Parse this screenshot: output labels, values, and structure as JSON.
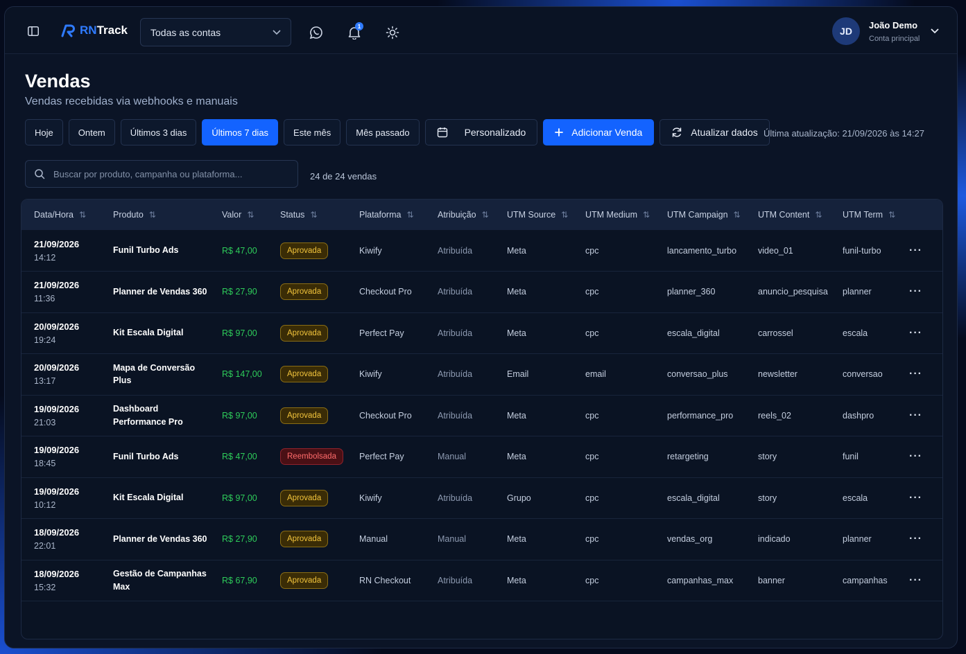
{
  "header": {
    "brand_prefix": "RN",
    "brand_suffix": "Track",
    "account_select": "Todas as contas",
    "notification_count": "1",
    "user": {
      "initials": "JD",
      "name": "João Demo",
      "role": "Conta principal"
    }
  },
  "page": {
    "title": "Vendas",
    "subtitle": "Vendas recebidas via webhooks e manuais"
  },
  "filters": {
    "today": "Hoje",
    "yesterday": "Ontem",
    "last3": "Últimos 3 dias",
    "last7": "Últimos 7 dias",
    "this_month": "Este mês",
    "last_month": "Mês passado",
    "custom": "Personalizado",
    "add_sale": "Adicionar Venda",
    "refresh": "Atualizar dados",
    "last_update": "Última atualização: 21/09/2026 às 14:27"
  },
  "search": {
    "placeholder": "Buscar por produto, campanha ou plataforma..."
  },
  "count": "24 de 24 vendas",
  "table": {
    "columns": [
      "Data/Hora",
      "Produto",
      "Valor",
      "Status",
      "Plataforma",
      "Atribuição",
      "UTM Source",
      "UTM Medium",
      "UTM Campaign",
      "UTM Content",
      "UTM Term"
    ],
    "rows": [
      {
        "date": "21/09/2026",
        "time": "14:12",
        "product": "Funil Turbo Ads",
        "value": "R$ 47,00",
        "status": "Aprovada",
        "platform": "Kiwify",
        "attribution": "Atribuída",
        "source": "Meta",
        "medium": "cpc",
        "campaign": "lancamento_turbo",
        "content": "video_01",
        "term": "funil-turbo"
      },
      {
        "date": "21/09/2026",
        "time": "11:36",
        "product": "Planner de Vendas 360",
        "value": "R$ 27,90",
        "status": "Aprovada",
        "platform": "Checkout Pro",
        "attribution": "Atribuída",
        "source": "Meta",
        "medium": "cpc",
        "campaign": "planner_360",
        "content": "anuncio_pesquisa",
        "term": "planner"
      },
      {
        "date": "20/09/2026",
        "time": "19:24",
        "product": "Kit Escala Digital",
        "value": "R$ 97,00",
        "status": "Aprovada",
        "platform": "Perfect Pay",
        "attribution": "Atribuída",
        "source": "Meta",
        "medium": "cpc",
        "campaign": "escala_digital",
        "content": "carrossel",
        "term": "escala"
      },
      {
        "date": "20/09/2026",
        "time": "13:17",
        "product": "Mapa de Conversão Plus",
        "value": "R$ 147,00",
        "status": "Aprovada",
        "platform": "Kiwify",
        "attribution": "Atribuída",
        "source": "Email",
        "medium": "email",
        "campaign": "conversao_plus",
        "content": "newsletter",
        "term": "conversao"
      },
      {
        "date": "19/09/2026",
        "time": "21:03",
        "product": "Dashboard Performance Pro",
        "value": "R$ 97,00",
        "status": "Aprovada",
        "platform": "Checkout Pro",
        "attribution": "Atribuída",
        "source": "Meta",
        "medium": "cpc",
        "campaign": "performance_pro",
        "content": "reels_02",
        "term": "dashpro"
      },
      {
        "date": "19/09/2026",
        "time": "18:45",
        "product": "Funil Turbo Ads",
        "value": "R$ 47,00",
        "status": "Reembolsada",
        "platform": "Perfect Pay",
        "attribution": "Manual",
        "source": "Meta",
        "medium": "cpc",
        "campaign": "retargeting",
        "content": "story",
        "term": "funil"
      },
      {
        "date": "19/09/2026",
        "time": "10:12",
        "product": "Kit Escala Digital",
        "value": "R$ 97,00",
        "status": "Aprovada",
        "platform": "Kiwify",
        "attribution": "Atribuída",
        "source": "Grupo",
        "medium": "cpc",
        "campaign": "escala_digital",
        "content": "story",
        "term": "escala"
      },
      {
        "date": "18/09/2026",
        "time": "22:01",
        "product": "Planner de Vendas 360",
        "value": "R$ 27,90",
        "status": "Aprovada",
        "platform": "Manual",
        "attribution": "Manual",
        "source": "Meta",
        "medium": "cpc",
        "campaign": "vendas_org",
        "content": "indicado",
        "term": "planner"
      },
      {
        "date": "18/09/2026",
        "time": "15:32",
        "product": "Gestão de Campanhas Max",
        "value": "R$ 67,90",
        "status": "Aprovada",
        "platform": "RN Checkout",
        "attribution": "Atribuída",
        "source": "Meta",
        "medium": "cpc",
        "campaign": "campanhas_max",
        "content": "banner",
        "term": "campanhas"
      }
    ]
  }
}
